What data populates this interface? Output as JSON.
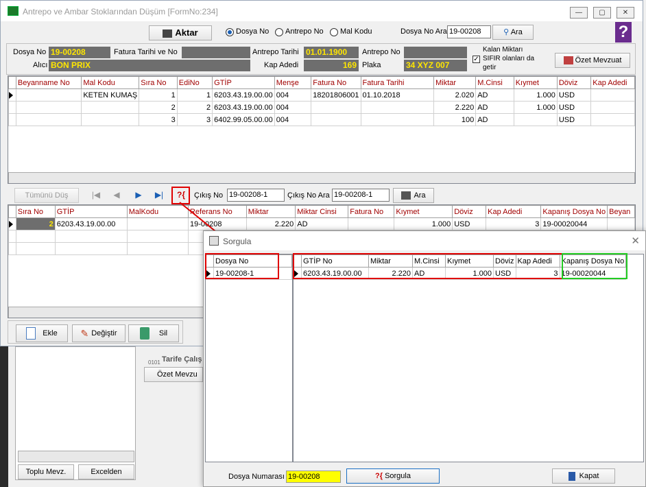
{
  "window": {
    "title": "Antrepo ve Ambar Stoklarından Düşüm [FormNo:234]",
    "min": "—",
    "max": "▢",
    "close": "✕"
  },
  "toolbar": {
    "aktar": "Aktar",
    "radios": [
      "Dosya No",
      "Antrepo No",
      "Mal Kodu"
    ],
    "dosya_no_ara_label": "Dosya No Ara",
    "dosya_no_ara_value": "19-00208",
    "ara": "Ara"
  },
  "info": {
    "dosya_no_label": "Dosya No",
    "dosya_no": "19-00208",
    "fatura_label": "Fatura Tarihi ve No",
    "antrepo_tarihi_label": "Antrepo Tarihi",
    "antrepo_tarihi": "01.01.1900",
    "antrepo_no_label": "Antrepo No",
    "kalan_line1": "Kalan Miktarı",
    "kalan_line2": "SIFIR olanları da",
    "kalan_line3": "getir",
    "ozet": "Özet Mevzuat",
    "alici_label": "Alıcı",
    "alici": "BON PRIX",
    "kap_adedi_label": "Kap Adedi",
    "kap_adedi": "169",
    "plaka_label": "Plaka",
    "plaka": "34 XYZ 007"
  },
  "grid1": {
    "headers": [
      "Beyanname No",
      "Mal Kodu",
      "Sıra No",
      "EdiNo",
      "GTİP",
      "Menşe",
      "Fatura No",
      "Fatura Tarihi",
      "Miktar",
      "M.Cinsi",
      "Kıymet",
      "Döviz",
      "Kap Adedi"
    ],
    "rows": [
      [
        "",
        "KETEN KUMAŞ",
        "1",
        "1",
        "6203.43.19.00.00",
        "004",
        "18201806001",
        "01.10.2018",
        "2.020",
        "AD",
        "1.000",
        "USD",
        ""
      ],
      [
        "",
        "",
        "2",
        "2",
        "6203.43.19.00.00",
        "004",
        "",
        "",
        "2.220",
        "AD",
        "1.000",
        "USD",
        ""
      ],
      [
        "",
        "",
        "3",
        "3",
        "6402.99.05.00.00",
        "004",
        "",
        "",
        "100",
        "AD",
        "",
        "USD",
        ""
      ]
    ]
  },
  "nav": {
    "tumunu_dus": "Tümünü Düş",
    "first": "|◀",
    "prev": "◀",
    "next": "▶",
    "last": "▶|",
    "cikis_no_label": "Çıkış No",
    "cikis_no": "19-00208-1",
    "cikis_no_ara_label": "Çıkış No Ara",
    "cikis_no_ara": "19-00208-1",
    "ara": "Ara"
  },
  "grid2": {
    "headers": [
      "Sıra No",
      "GTİP",
      "MalKodu",
      "Referans No",
      "Miktar",
      "Miktar Cinsi",
      "Fatura No",
      "Kıymet",
      "Döviz",
      "Kap Adedi",
      "Kapanış Dosya No",
      "Beyan"
    ],
    "rows": [
      [
        "2",
        "6203.43.19.00.00",
        "",
        "19-00208",
        "2.220",
        "AD",
        "",
        "1.000",
        "USD",
        "3",
        "19-00020044",
        ""
      ]
    ]
  },
  "bottom": {
    "ekle": "Ekle",
    "degistir": "Değiştir",
    "sil": "Sil"
  },
  "background": {
    "tarife": "Tarife Çalış",
    "ozet_mevzu": "Özet Mevzu",
    "toplu": "Toplu Mevz.",
    "excelden": "Excelden",
    "code": "0101"
  },
  "dialog": {
    "title": "Sorgula",
    "left_header": "Dosya No",
    "left_value": "19-00208-1",
    "headers": [
      "GTİP No",
      "Miktar",
      "M.Cinsi",
      "Kıymet",
      "Döviz",
      "Kap Adedi",
      "Kapanış Dosya No"
    ],
    "row": [
      "6203.43.19.00.00",
      "2.220",
      "AD",
      "1.000",
      "USD",
      "3",
      "19-00020044"
    ],
    "dosya_numarasi_label": "Dosya Numarası",
    "dosya_numarasi": "19-00208",
    "sorgula": "Sorgula",
    "kapat": "Kapat"
  }
}
